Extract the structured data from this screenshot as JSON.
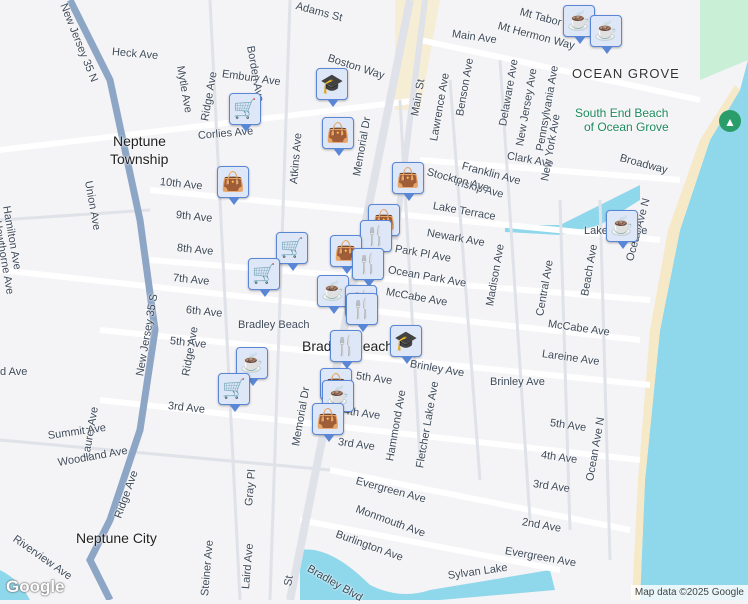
{
  "map": {
    "labels": [
      "Adams St",
      "Boston Way",
      "Heck Ave",
      "Embury Ave",
      "Borden Ave",
      "Corlies Ave",
      "Ridge Ave",
      "Mytle Ave",
      "Neptune",
      "Township",
      "Atkins Ave",
      "Memorial Dr",
      "10th Ave",
      "9th Ave",
      "8th Ave",
      "7th Ave",
      "6th Ave",
      "5th Ave",
      "Union Ave",
      "Hamilton Ave",
      "Hawthorne Ave",
      "New Jersey 35 N",
      "New Jersey 35 S",
      "Ridge Ave",
      "3rd Ave",
      "Laurel Ave",
      "Summit Ave",
      "Woodland Ave",
      "Ridge Ave",
      "Riverview Ave",
      "Neptune City",
      "Steiner Ave",
      "Laird Ave",
      "Gray Pl",
      "Memorial Dr",
      "St",
      "Bradley Beach",
      "Bradley Beach",
      "Main St",
      "Lawrence Ave",
      "Benson Ave",
      "Delaware Ave",
      "New Jersey Ave",
      "Pennsylvania Ave",
      "Clark Ave",
      "New York Ave",
      "Franklin Ave",
      "Inskip Ave",
      "Stockton Ave",
      "Broadway",
      "Main Ave",
      "Mt Hermon Way",
      "Mt Tabor Way",
      "OCEAN GROVE",
      "South End Beach",
      "of Ocean Grove",
      "Lake Terrace",
      "Newark Ave",
      "Park Pl Ave",
      "Ocean Park Ave",
      "McCabe Ave",
      "McCabe Ave",
      "Lareine Ave",
      "Brinley Ave",
      "Brinley Ave",
      "Madison Ave",
      "Central Ave",
      "Beach Ave",
      "Ocean Ave N",
      "Ocean Ave N",
      "Lake Terrace",
      "Hammond Ave",
      "Fletcher Lake Ave",
      "5th Ave",
      "4th Ave",
      "3rd Ave",
      "2nd Ave",
      "Evergreen Ave",
      "Evergreen Ave",
      "Monmouth Ave",
      "Burlington Ave",
      "Bradley Blvd",
      "Sylvan Lake",
      "5th Ave",
      "4th Ave",
      "3rd Ave",
      "d Ave"
    ],
    "markers": [
      "coffee",
      "coffee",
      "school",
      "shopping-cart",
      "shopping-bag",
      "shopping-bag",
      "shopping-bag",
      "shopping-bag",
      "shopping-cart",
      "shopping-cart",
      "restaurant",
      "shopping-bag",
      "restaurant",
      "coffee",
      "restaurant",
      "restaurant",
      "school",
      "restaurant",
      "coffee",
      "shopping-cart",
      "shopping-bag",
      "coffee",
      "shopping-bag",
      "coffee"
    ],
    "attribution": "Map data ©2025 Google",
    "logo": "Google"
  },
  "colors": {
    "water": "#8fd8ec",
    "land": "#f4f3f5",
    "road": "#ffffff",
    "highway": "#8ea6c6",
    "beach": "#f6e9c8",
    "park": "#c9efd6",
    "marker": "#dde7f8"
  }
}
